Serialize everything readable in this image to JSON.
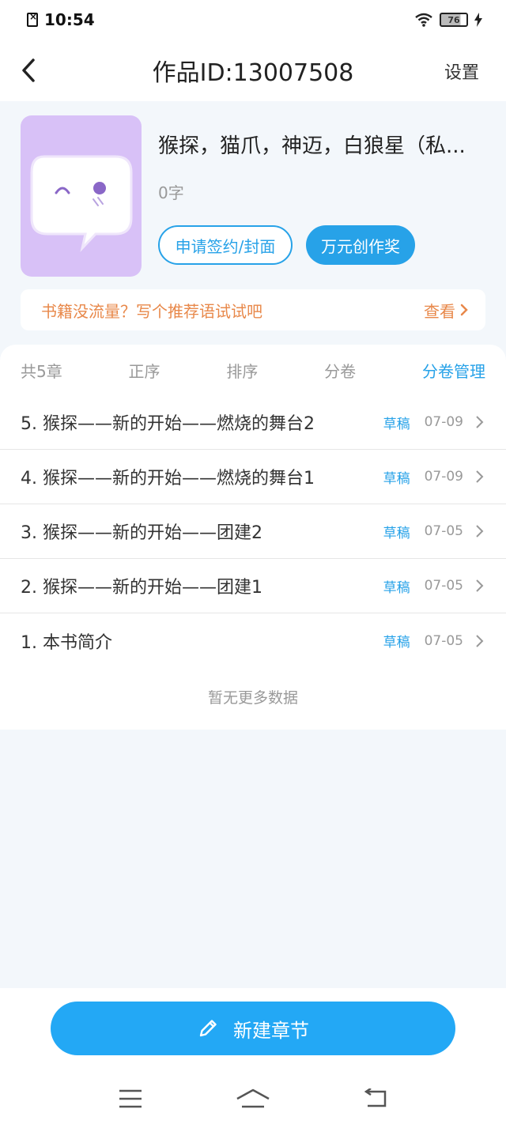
{
  "status_bar": {
    "time": "10:54",
    "battery": "76"
  },
  "header": {
    "title": "作品ID:13007508",
    "settings_label": "设置"
  },
  "book": {
    "title": "猴探，猫爪，神迈，白狼星（私...",
    "word_count": "0字",
    "sign_button": "申请签约/封面",
    "award_button": "万元创作奖"
  },
  "tip": {
    "text": "书籍没流量？写个推荐语试试吧",
    "action": "查看"
  },
  "list_header": {
    "count": "共5章",
    "order": "正序",
    "sort": "排序",
    "volume": "分卷",
    "volume_manage": "分卷管理"
  },
  "chapters": [
    {
      "title": "5. 猴探——新的开始——燃烧的舞台2",
      "status": "草稿",
      "date": "07-09"
    },
    {
      "title": "4. 猴探——新的开始——燃烧的舞台1",
      "status": "草稿",
      "date": "07-09"
    },
    {
      "title": "3. 猴探——新的开始——团建2",
      "status": "草稿",
      "date": "07-05"
    },
    {
      "title": "2. 猴探——新的开始——团建1",
      "status": "草稿",
      "date": "07-05"
    },
    {
      "title": "1. 本书简介",
      "status": "草稿",
      "date": "07-05"
    }
  ],
  "no_more": "暂无更多数据",
  "new_chapter_button": "新建章节",
  "colors": {
    "accent": "#27a2e8",
    "tip": "#e8884a",
    "cover": "#d8c1f7"
  }
}
